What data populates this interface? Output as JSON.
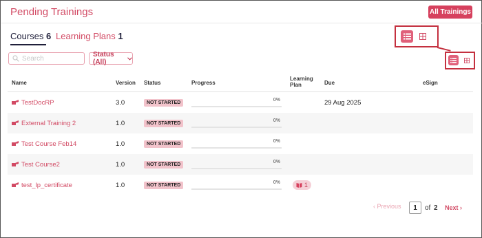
{
  "header": {
    "title": "Pending Trainings",
    "all_trainings_label": "All Trainings"
  },
  "tabs": [
    {
      "label": "Courses",
      "count": "6",
      "active": true
    },
    {
      "label": "Learning Plans",
      "count": "1",
      "active": false
    }
  ],
  "view_toggle": {
    "list_icon": "list-view-icon",
    "grid_icon": "grid-view-icon",
    "active": "list"
  },
  "filters": {
    "search_placeholder": "Search",
    "search_value": "",
    "status_label": "Status (All)"
  },
  "table": {
    "columns": {
      "name": "Name",
      "version": "Version",
      "status": "Status",
      "progress": "Progress",
      "learning_plan_line1": "Learning",
      "learning_plan_line2": "Plan",
      "due": "Due",
      "esign": "eSign"
    },
    "rows": [
      {
        "name": "TestDocRP",
        "version": "3.0",
        "status": "NOT STARTED",
        "progress_pct": 0,
        "progress_label": "0%",
        "learning_plan": "",
        "due": "29 Aug 2025",
        "esign": ""
      },
      {
        "name": "External Training 2",
        "version": "1.0",
        "status": "NOT STARTED",
        "progress_pct": 0,
        "progress_label": "0%",
        "learning_plan": "",
        "due": "",
        "esign": ""
      },
      {
        "name": "Test Course Feb14",
        "version": "1.0",
        "status": "NOT STARTED",
        "progress_pct": 0,
        "progress_label": "0%",
        "learning_plan": "",
        "due": "",
        "esign": ""
      },
      {
        "name": "Test Course2",
        "version": "1.0",
        "status": "NOT STARTED",
        "progress_pct": 0,
        "progress_label": "0%",
        "learning_plan": "",
        "due": "",
        "esign": ""
      },
      {
        "name": "test_lp_certificate",
        "version": "1.0",
        "status": "NOT STARTED",
        "progress_pct": 0,
        "progress_label": "0%",
        "learning_plan": "1",
        "due": "",
        "esign": ""
      }
    ]
  },
  "pagination": {
    "previous_label": "‹ Previous",
    "current_page": "1",
    "of_label": "of",
    "total_pages": "2",
    "next_label": "Next ›"
  },
  "colors": {
    "accent": "#d6415e",
    "link": "#d24a64",
    "callout": "#c4303f",
    "badge_bg": "#f2c3cb"
  }
}
